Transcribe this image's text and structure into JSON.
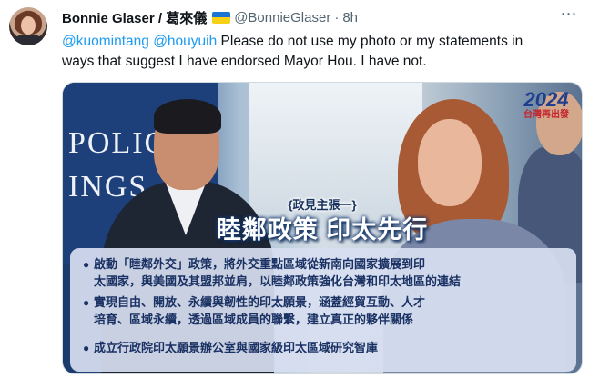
{
  "tweet": {
    "author": {
      "display_name": "Bonnie Glaser / 葛來儀",
      "flag": "ukraine-flag",
      "handle": "@BonnieGlaser",
      "separator": "·",
      "time": "8h"
    },
    "more_icon": "⋯",
    "mention_1": "@kuomintang",
    "mention_2": "@houyuih",
    "text_line_1": "Please do not use my photo or my statements in",
    "text_line_2": "ways that suggest I have endorsed Mayor Hou. I have not."
  },
  "media": {
    "banner_words": [
      "POLIC",
      "INGS"
    ],
    "logo_year": "2024",
    "logo_sub": "台灣再出發",
    "subtitle": "{政見主張一}",
    "headline": "睦鄰政策 印太先行",
    "bullets": [
      {
        "line_1": "啟動「睦鄰外交」政策，將外交重點區域從新南向國家擴展到印",
        "line_2": "太國家，與美國及其盟邦並肩，以睦鄰政策強化台灣和印太地區的連結"
      },
      {
        "line_1": "實現自由、開放、永續與韌性的印太願景，涵蓋經貿互動、人才",
        "line_2": "培育、區域永續，透過區域成員的聯繫，建立真正的夥伴關係"
      },
      {
        "line_1": "成立行政院印太願景辦公室與國家級印太區域研究智庫"
      }
    ]
  }
}
